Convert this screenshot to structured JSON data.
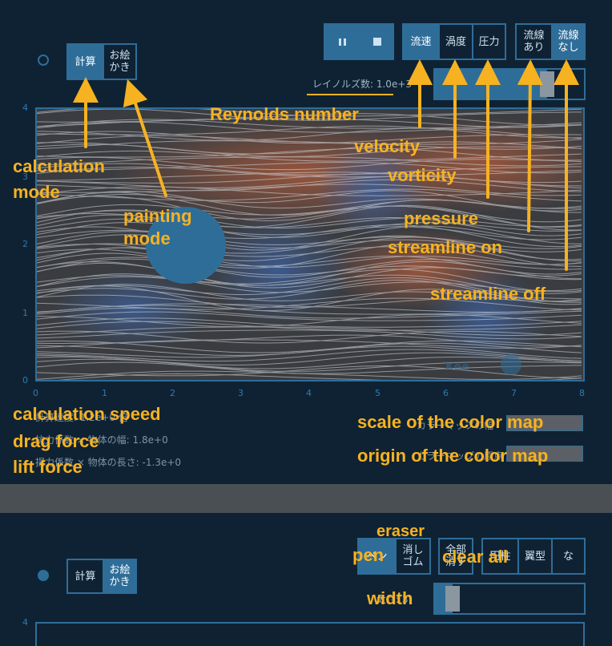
{
  "top": {
    "mode": {
      "calc": "計算",
      "paint": "お絵\nかき"
    },
    "playback": {
      "pause_icon": "pause-icon",
      "stop_icon": "stop-icon"
    },
    "view": {
      "velocity": "流速",
      "vorticity": "渦度",
      "pressure": "圧力"
    },
    "streamline": {
      "on": "流線\nあり",
      "off": "流線\nなし"
    },
    "reynolds_label": "レイノルズ数: 1.0e+3",
    "reynolds_slider_value": 0.75,
    "plot": {
      "x_ticks": [
        "0",
        "1",
        "2",
        "3",
        "4",
        "5",
        "6",
        "7",
        "8"
      ],
      "y_ticks": [
        "4",
        "3",
        "2",
        "1",
        "0"
      ],
      "logo_text": "Kee"
    },
    "info": {
      "speed": "計算速度: 1.2e+0 倍",
      "drag": "抗力係数 × 物体の幅: 1.8e+0",
      "lift": "揚力係数 × 物体の長さ: -1.3e+0",
      "colormap_scale": "カラーマップの幅",
      "colormap_origin": "カラーマップの原点"
    }
  },
  "bottom": {
    "mode": {
      "calc": "計算",
      "paint": "お絵\nかき"
    },
    "tools": {
      "pen": "ペン",
      "eraser": "消し\nゴム",
      "clear": "全部\n消す"
    },
    "shapes": {
      "cylinder": "円柱",
      "wing": "翼型",
      "none": "な"
    },
    "width_label": "太さ: 3",
    "width_slider_value": 0.12,
    "y_tick_top": "4"
  },
  "annotations": {
    "reynolds": "Reynolds number",
    "calc_mode": "calculation\nmode",
    "paint_mode": "painting\nmode",
    "velocity": "velocity",
    "vorticity": "vorticity",
    "pressure": "pressure",
    "stream_on": "streamline on",
    "stream_off": "streamline off",
    "calc_speed": "calculation speed",
    "drag": "drag force",
    "lift": "lift force",
    "scale": "scale of the color map",
    "origin": "origin of the color map",
    "eraser": "eraser",
    "pen": "pen",
    "clear": "clear all",
    "width": "width"
  },
  "colors": {
    "accent": "#2f6d99",
    "annotation": "#f6b221",
    "background": "#0f2233"
  }
}
